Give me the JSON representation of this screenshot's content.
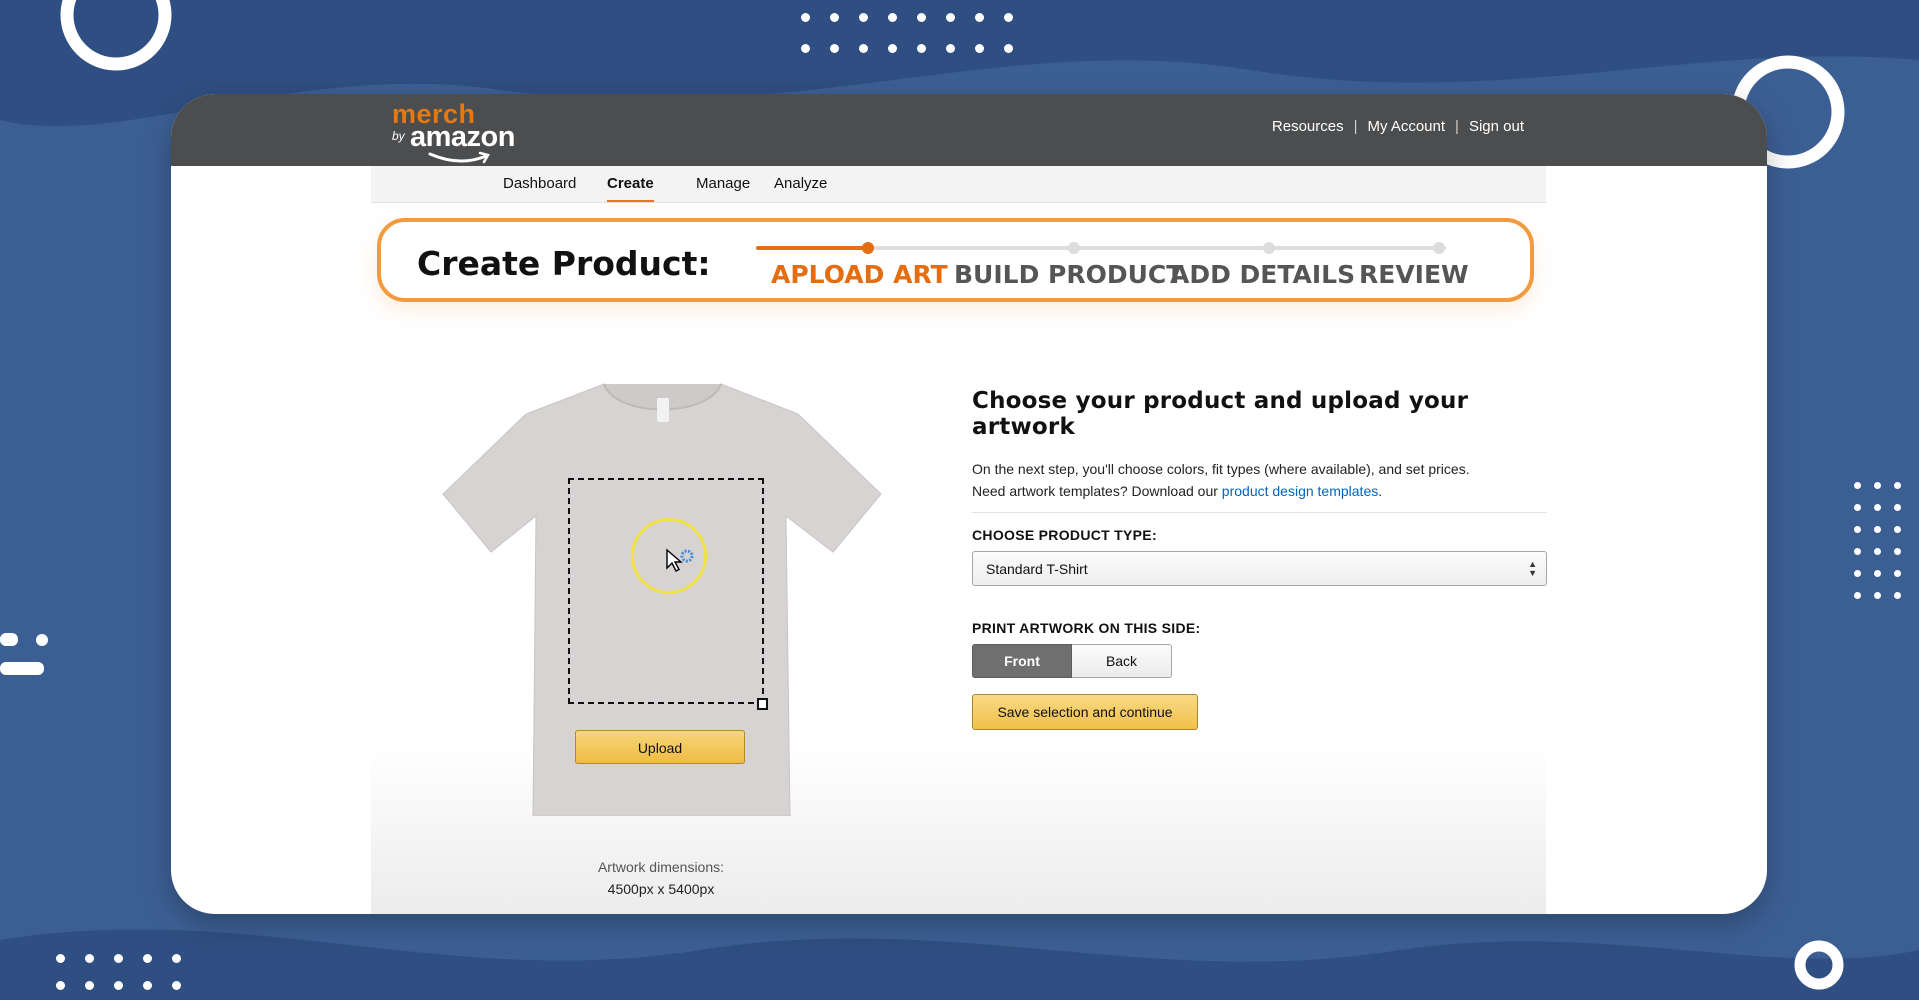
{
  "header": {
    "logo_merch": "merch",
    "logo_by": "by",
    "logo_amazon": "amazon",
    "links": [
      "Resources",
      "My Account",
      "Sign out"
    ]
  },
  "nav": {
    "tabs": [
      "Dashboard",
      "Create",
      "Manage",
      "Analyze"
    ],
    "active": "Create"
  },
  "stepper": {
    "title": "Create Product:",
    "steps": [
      "APLOAD ART",
      "BUILD PRODUCT",
      "ADD DETAILS",
      "REVIEW"
    ],
    "active_step": "APLOAD ART"
  },
  "preview": {
    "upload_label": "Upload",
    "dims_label": "Artwork dimensions:",
    "dims_value": "4500px x 5400px"
  },
  "panel": {
    "heading": "Choose your product and upload your artwork",
    "line1": "On the next step, you'll choose colors, fit types (where available), and set prices.",
    "line2_prefix": "Need artwork templates? Download our ",
    "line2_link": "product design templates",
    "line2_suffix": ".",
    "product_type_label": "CHOOSE PRODUCT TYPE:",
    "product_type_value": "Standard T-Shirt",
    "side_label": "PRINT ARTWORK ON THIS SIDE:",
    "side_options": [
      "Front",
      "Back"
    ],
    "side_selected": "Front",
    "save_label": "Save selection and continue"
  },
  "colors": {
    "background": "#3c5f93",
    "accent_orange": "#e46d12",
    "topbar": "#4b4d4f",
    "button_gold": "#f0c14b",
    "link": "#0066c0"
  }
}
